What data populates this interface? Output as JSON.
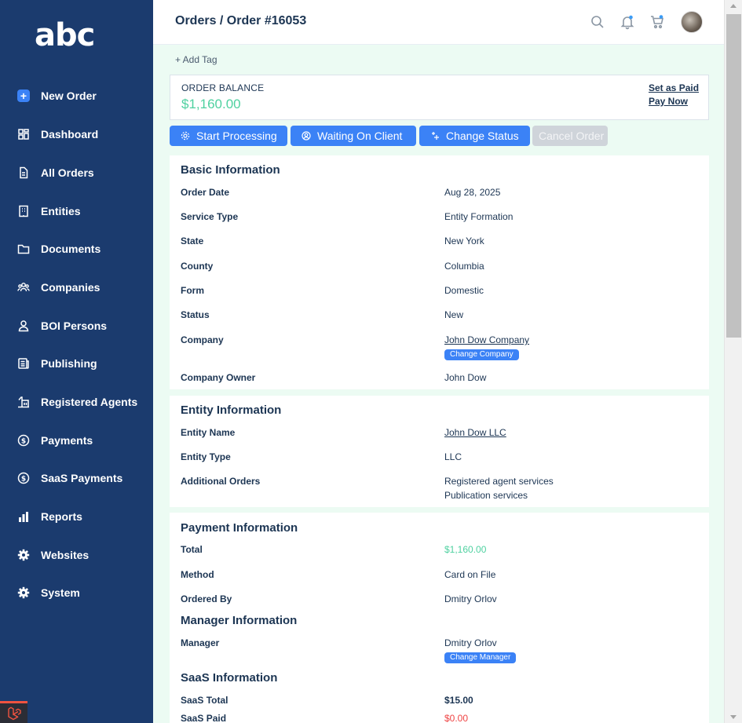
{
  "brand": {
    "logo_text": "abc"
  },
  "sidebar": {
    "items": [
      {
        "label": "New Order",
        "icon": "plus-icon"
      },
      {
        "label": "Dashboard",
        "icon": "dashboard-icon"
      },
      {
        "label": "All Orders",
        "icon": "document-icon"
      },
      {
        "label": "Entities",
        "icon": "building-icon"
      },
      {
        "label": "Documents",
        "icon": "folder-icon"
      },
      {
        "label": "Companies",
        "icon": "users-icon"
      },
      {
        "label": "BOI Persons",
        "icon": "person-icon"
      },
      {
        "label": "Publishing",
        "icon": "newspaper-icon"
      },
      {
        "label": "Registered Agents",
        "icon": "bank-icon"
      },
      {
        "label": "Payments",
        "icon": "dollar-icon"
      },
      {
        "label": "SaaS Payments",
        "icon": "dollar-icon"
      },
      {
        "label": "Reports",
        "icon": "bar-chart-icon"
      },
      {
        "label": "Websites",
        "icon": "gear-icon"
      },
      {
        "label": "System",
        "icon": "gear-icon"
      }
    ]
  },
  "header": {
    "breadcrumb": "Orders / Order #16053"
  },
  "tags": {
    "add_label": "+ Add Tag"
  },
  "balance": {
    "label": "ORDER BALANCE",
    "value": "$1,160.00",
    "set_paid_label": "Set as Paid",
    "pay_now_label": "Pay Now"
  },
  "actions": {
    "start_processing": "Start Processing",
    "waiting_on_client": "Waiting On Client",
    "change_status": "Change Status",
    "cancel_order": "Cancel Order"
  },
  "basic_info": {
    "title": "Basic Information",
    "order_date_label": "Order Date",
    "order_date": "Aug 28, 2025",
    "service_type_label": "Service Type",
    "service_type": "Entity Formation",
    "state_label": "State",
    "state": "New York",
    "county_label": "County",
    "county": "Columbia",
    "form_label": "Form",
    "form": "Domestic",
    "status_label": "Status",
    "status": "New",
    "company_label": "Company",
    "company": "John Dow Company",
    "change_company_label": "Change Company",
    "company_owner_label": "Company Owner",
    "company_owner": "John Dow"
  },
  "entity_info": {
    "title": "Entity Information",
    "entity_name_label": "Entity Name",
    "entity_name": "John Dow LLC",
    "entity_type_label": "Entity Type",
    "entity_type": "LLC",
    "additional_orders_label": "Additional Orders",
    "additional_orders": [
      "Registered agent services",
      "Publication services"
    ]
  },
  "payment_info": {
    "title": "Payment Information",
    "total_label": "Total",
    "total": "$1,160.00",
    "method_label": "Method",
    "method": "Card on File",
    "ordered_by_label": "Ordered By",
    "ordered_by": "Dmitry Orlov"
  },
  "manager_info": {
    "title": "Manager Information",
    "manager_label": "Manager",
    "manager": "Dmitry Orlov",
    "change_manager_label": "Change Manager"
  },
  "saas_info": {
    "title": "SaaS Information",
    "saas_total_label": "SaaS Total",
    "saas_total": "$15.00",
    "saas_paid_label": "SaaS Paid",
    "saas_paid": "$0.00"
  },
  "colors": {
    "sidebar_bg": "#1b3b6e",
    "accent_blue": "#3b82f6",
    "money_green": "#4fd1a0",
    "alert_red": "#ef4444",
    "page_bg": "#ecfbf3"
  }
}
